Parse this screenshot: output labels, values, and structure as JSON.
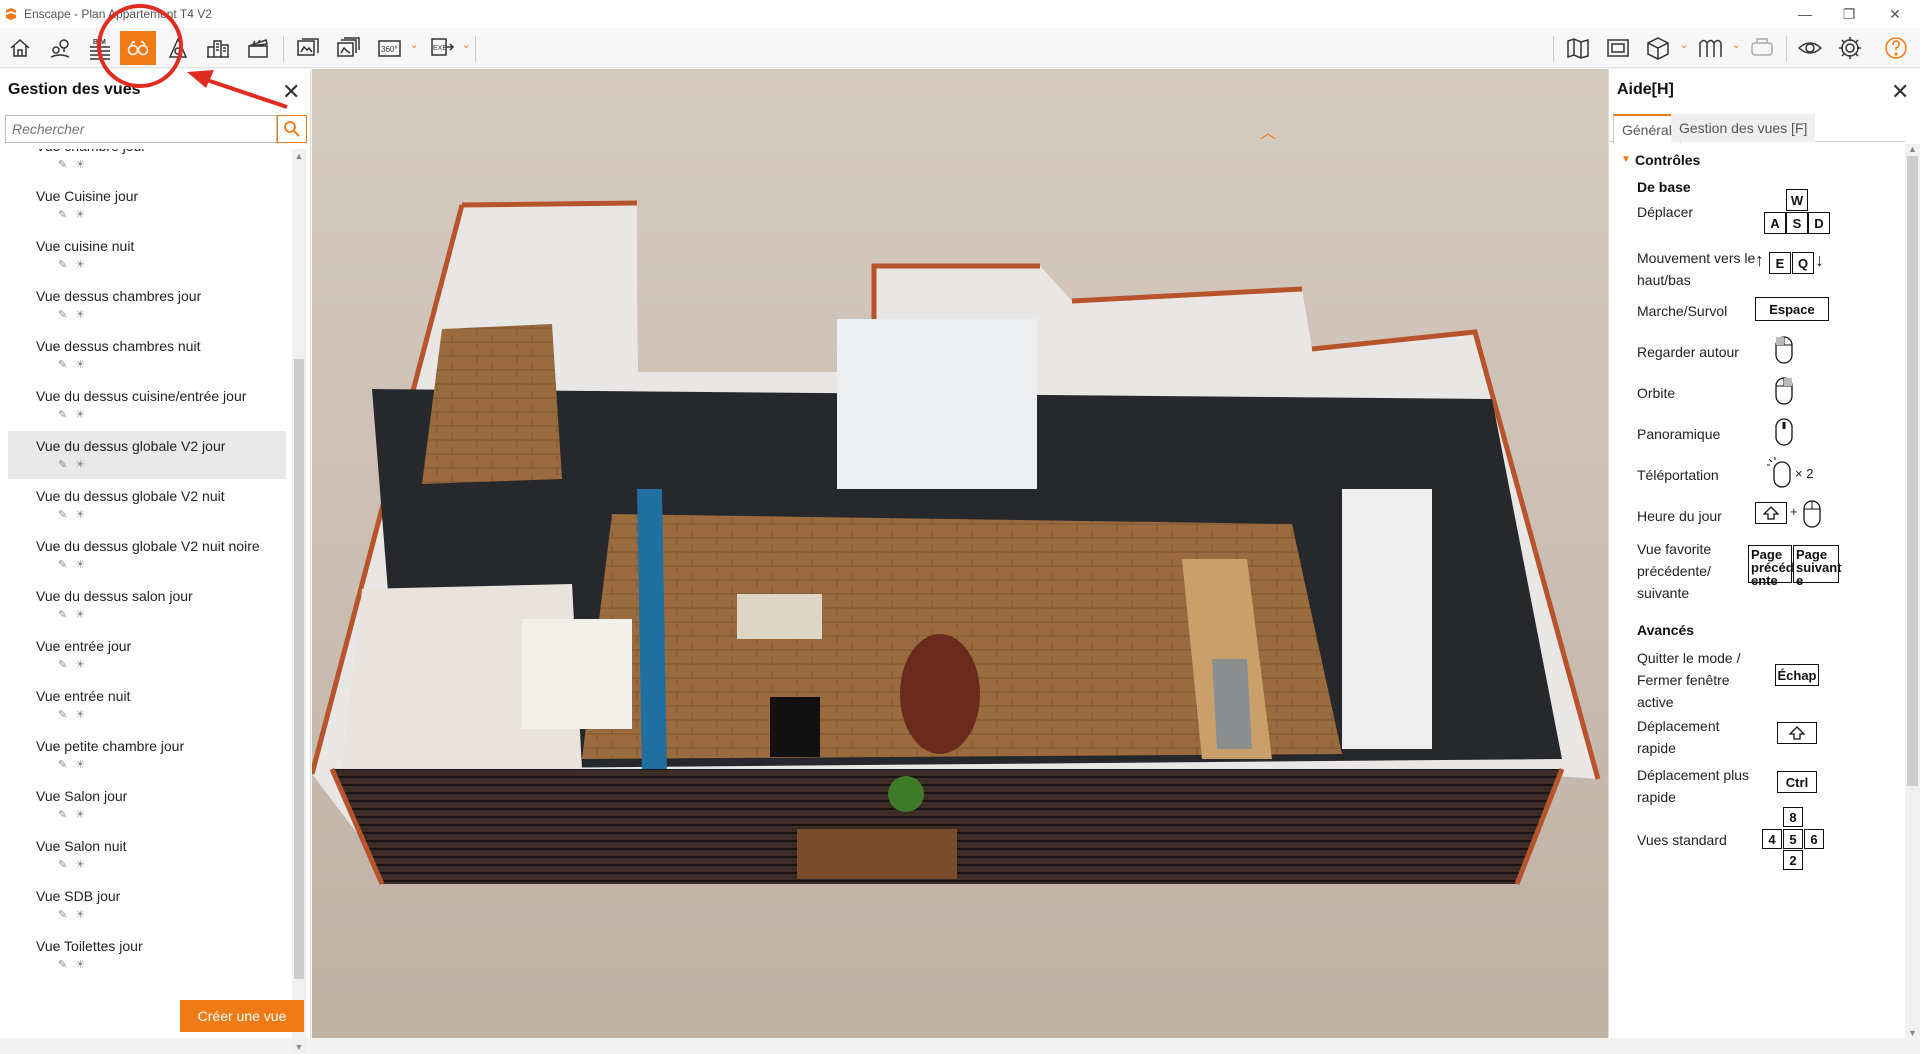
{
  "app": {
    "title": "Enscape - Plan Appartement T4 V2"
  },
  "colors": {
    "accent": "#f07b16",
    "annotation": "#e02b20"
  },
  "toolbar": {
    "buttons": [
      "home-icon",
      "location-pins-icon",
      "bim-icon",
      "views-binoculars-icon",
      "asset-library-icon",
      "buildings-icon",
      "video-editor-icon",
      "render-image-icon",
      "batch-render-icon",
      "panorama-360-icon",
      "export-exe-icon",
      "map-icon",
      "screenshot-icon",
      "cube-icon",
      "material-icon",
      "vr-headset-icon",
      "visual-settings-icon",
      "settings-gear-icon",
      "help-icon"
    ],
    "bim_label": "BIM",
    "pano_label": "360°",
    "exe_label": "EXE"
  },
  "left_panel": {
    "title": "Gestion des vues",
    "search_placeholder": "Rechercher",
    "views": [
      "Vue chambre jour",
      "Vue Cuisine jour",
      "Vue cuisine nuit",
      "Vue dessus chambres jour",
      "Vue dessus chambres nuit",
      "Vue du dessus cuisine/entrée jour",
      "Vue du dessus globale V2 jour",
      "Vue du dessus globale V2 nuit",
      "Vue du dessus globale V2 nuit noire",
      "Vue du dessus salon jour",
      "Vue entrée jour",
      "Vue entrée nuit",
      "Vue petite chambre jour",
      "Vue Salon  jour",
      "Vue Salon nuit",
      "Vue SDB jour",
      "Vue Toilettes jour"
    ],
    "selected_view": "Vue du dessus globale V2 jour",
    "create_button": "Créer une vue"
  },
  "right_panel": {
    "title": "Aide[H]",
    "tabs": [
      "Général",
      "Gestion des vues [F]"
    ],
    "active_tab": "Général",
    "section": "Contrôles",
    "subsection_basic": "De base",
    "subsection_advanced": "Avancés",
    "items": {
      "deplacer": "Déplacer",
      "mouvement": "Mouvement vers le haut/bas",
      "marche": "Marche/Survol",
      "regarder": "Regarder autour",
      "orbite": "Orbite",
      "panoramique": "Panoramique",
      "teleportation": "Téléportation",
      "heure": "Heure du jour",
      "vue_favorite": "Vue favorite précédente/ suivante",
      "quitter": "Quitter le mode / Fermer fenêtre active",
      "deplacement_rapide": "Déplacement rapide",
      "deplacement_plus": "Déplacement plus rapide",
      "vues_standard": "Vues standard"
    },
    "keys": {
      "w": "W",
      "a": "A",
      "s": "S",
      "d": "D",
      "e": "E",
      "q": "Q",
      "espace": "Espace",
      "times2": "× 2",
      "plus": "+",
      "page_prev": "Page précéd ente",
      "page_next": "Page suivant e",
      "echap": "Échap",
      "ctrl": "Ctrl",
      "k8": "8",
      "k4": "4",
      "k5": "5",
      "k6": "6",
      "k2": "2"
    }
  }
}
